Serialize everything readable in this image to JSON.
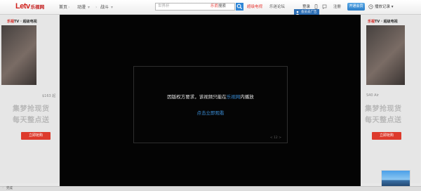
{
  "brand": {
    "logo_main": "Letv",
    "logo_sub": "乐视网"
  },
  "nav": {
    "home": "首页",
    "anime": "动漫",
    "fighting": "战斗",
    "search_placeholder": "世界杯",
    "search_brand_a": "乐而",
    "search_brand_b": "搜索",
    "super_tv": "超级电视",
    "forum": "乐迷论坛",
    "login": "登录",
    "register": "注册",
    "vip_button": "开通会员",
    "history": "播放记录",
    "ad_free": "会员去广告"
  },
  "player": {
    "message_prefix": "因版权方要求，该视频只能在",
    "message_link": "乐视网",
    "message_suffix": "内播放",
    "watch_link": "点击立即观看",
    "counter": "< 12 >"
  },
  "side_ads": {
    "brand_red": "乐视",
    "brand_black": "TV · 超级电视",
    "line1": "集梦抢现货",
    "line2": "每天整点送",
    "button": "立即抢购",
    "price_left": "$163 起",
    "price_right": "S40 Air"
  },
  "statusbar": {
    "left_text": "完成"
  },
  "colors": {
    "accent_blue": "#2f86d6",
    "brand_red": "#d0201b",
    "link_blue": "#3b8fd9",
    "player_bg": "#040404"
  }
}
